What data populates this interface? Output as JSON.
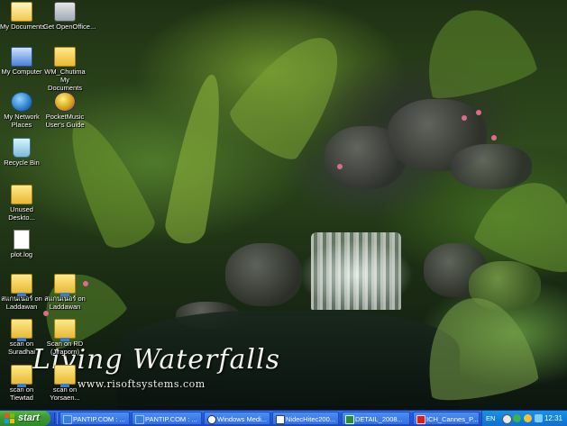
{
  "wallpaper": {
    "title": "Living Waterfalls",
    "url": "www.risoftsystems.com"
  },
  "desktop_icons": [
    {
      "label": "My Documents",
      "icon": "my-documents-icon"
    },
    {
      "label": "Get OpenOffice...",
      "icon": "openoffice-icon"
    },
    {
      "label": "My Computer",
      "icon": "my-computer-icon"
    },
    {
      "label": "WM_Chutima My Documents",
      "icon": "shortcut-folder-icon"
    },
    {
      "label": "My Network Places",
      "icon": "network-places-icon"
    },
    {
      "label": "PocketMusic User's Guide",
      "icon": "pocketmusic-icon"
    },
    {
      "label": "Recycle Bin",
      "icon": "recycle-bin-icon"
    },
    {
      "label": "Unused Deskto...",
      "icon": "folder-icon"
    },
    {
      "label": "plot.log",
      "icon": "text-file-icon"
    },
    {
      "label": "สแกนเนอร์ on Laddawan",
      "icon": "network-folder-icon"
    },
    {
      "label": "สแกนเนอร์ on Laddawan",
      "icon": "network-folder-icon"
    },
    {
      "label": "scan on Suradhai",
      "icon": "network-folder-icon"
    },
    {
      "label": "Scan on RD (Jiraporn)",
      "icon": "network-folder-icon"
    },
    {
      "label": "scan on Tiewtad",
      "icon": "network-folder-icon"
    },
    {
      "label": "scan on Yorsaen...",
      "icon": "network-folder-icon"
    }
  ],
  "taskbar": {
    "start_label": "start",
    "buttons": [
      {
        "label": "PANTIP.COM : ...",
        "icon": "ie-icon"
      },
      {
        "label": "PANTIP.COM : ...",
        "icon": "ie-icon"
      },
      {
        "label": "Windows Medi...",
        "icon": "media-player-icon"
      },
      {
        "label": "NidecHitec200...",
        "icon": "document-icon"
      },
      {
        "label": "DETAIL_2008...",
        "icon": "spreadsheet-icon"
      },
      {
        "label": "ICH_Cannes_P...",
        "icon": "pdf-icon"
      }
    ],
    "tray": {
      "language": "EN",
      "clock": "12:31"
    }
  }
}
